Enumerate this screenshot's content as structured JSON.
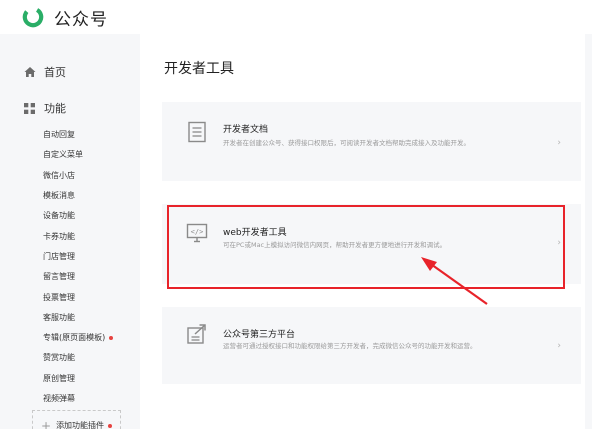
{
  "app": {
    "name": "公众号"
  },
  "sidebar": {
    "home_label": "首页",
    "func_label": "功能",
    "sub_items": [
      {
        "label": "自动回复",
        "dot": false
      },
      {
        "label": "自定义菜单",
        "dot": false
      },
      {
        "label": "微信小店",
        "dot": false
      },
      {
        "label": "模板消息",
        "dot": false
      },
      {
        "label": "设备功能",
        "dot": false
      },
      {
        "label": "卡券功能",
        "dot": false
      },
      {
        "label": "门店管理",
        "dot": false
      },
      {
        "label": "留言管理",
        "dot": false
      },
      {
        "label": "投票管理",
        "dot": false
      },
      {
        "label": "客服功能",
        "dot": false
      },
      {
        "label": "专辑(原页面模板)",
        "dot": true
      },
      {
        "label": "赞赏功能",
        "dot": false
      },
      {
        "label": "原创管理",
        "dot": false
      },
      {
        "label": "视频弹幕",
        "dot": false
      }
    ],
    "add_plugin_label": "添加功能插件"
  },
  "main": {
    "title": "开发者工具",
    "cards": {
      "doc": {
        "title": "开发者文档",
        "desc": "开发者在创建公众号、获得接口权限后，可阅读开发者文档帮助完成接入及功能开发。",
        "icon": "document-icon"
      },
      "web": {
        "title": "web开发者工具",
        "desc": "可在PC或Mac上模拟访问微信内网页，帮助开发者更方便地进行开发和调试。",
        "icon": "code-monitor-icon"
      },
      "third": {
        "title": "公众号第三方平台",
        "desc": "运营者可通过授权接口和功能权限给第三方开发者，完成微信公众号的功能开发和运营。",
        "icon": "authorize-icon"
      }
    },
    "chevron": "›"
  },
  "annotation": {
    "color": "#e8232a"
  },
  "colors": {
    "brand_green": "#2aae67",
    "red_dot": "#e64340",
    "card_bg": "#f6f7f9"
  }
}
